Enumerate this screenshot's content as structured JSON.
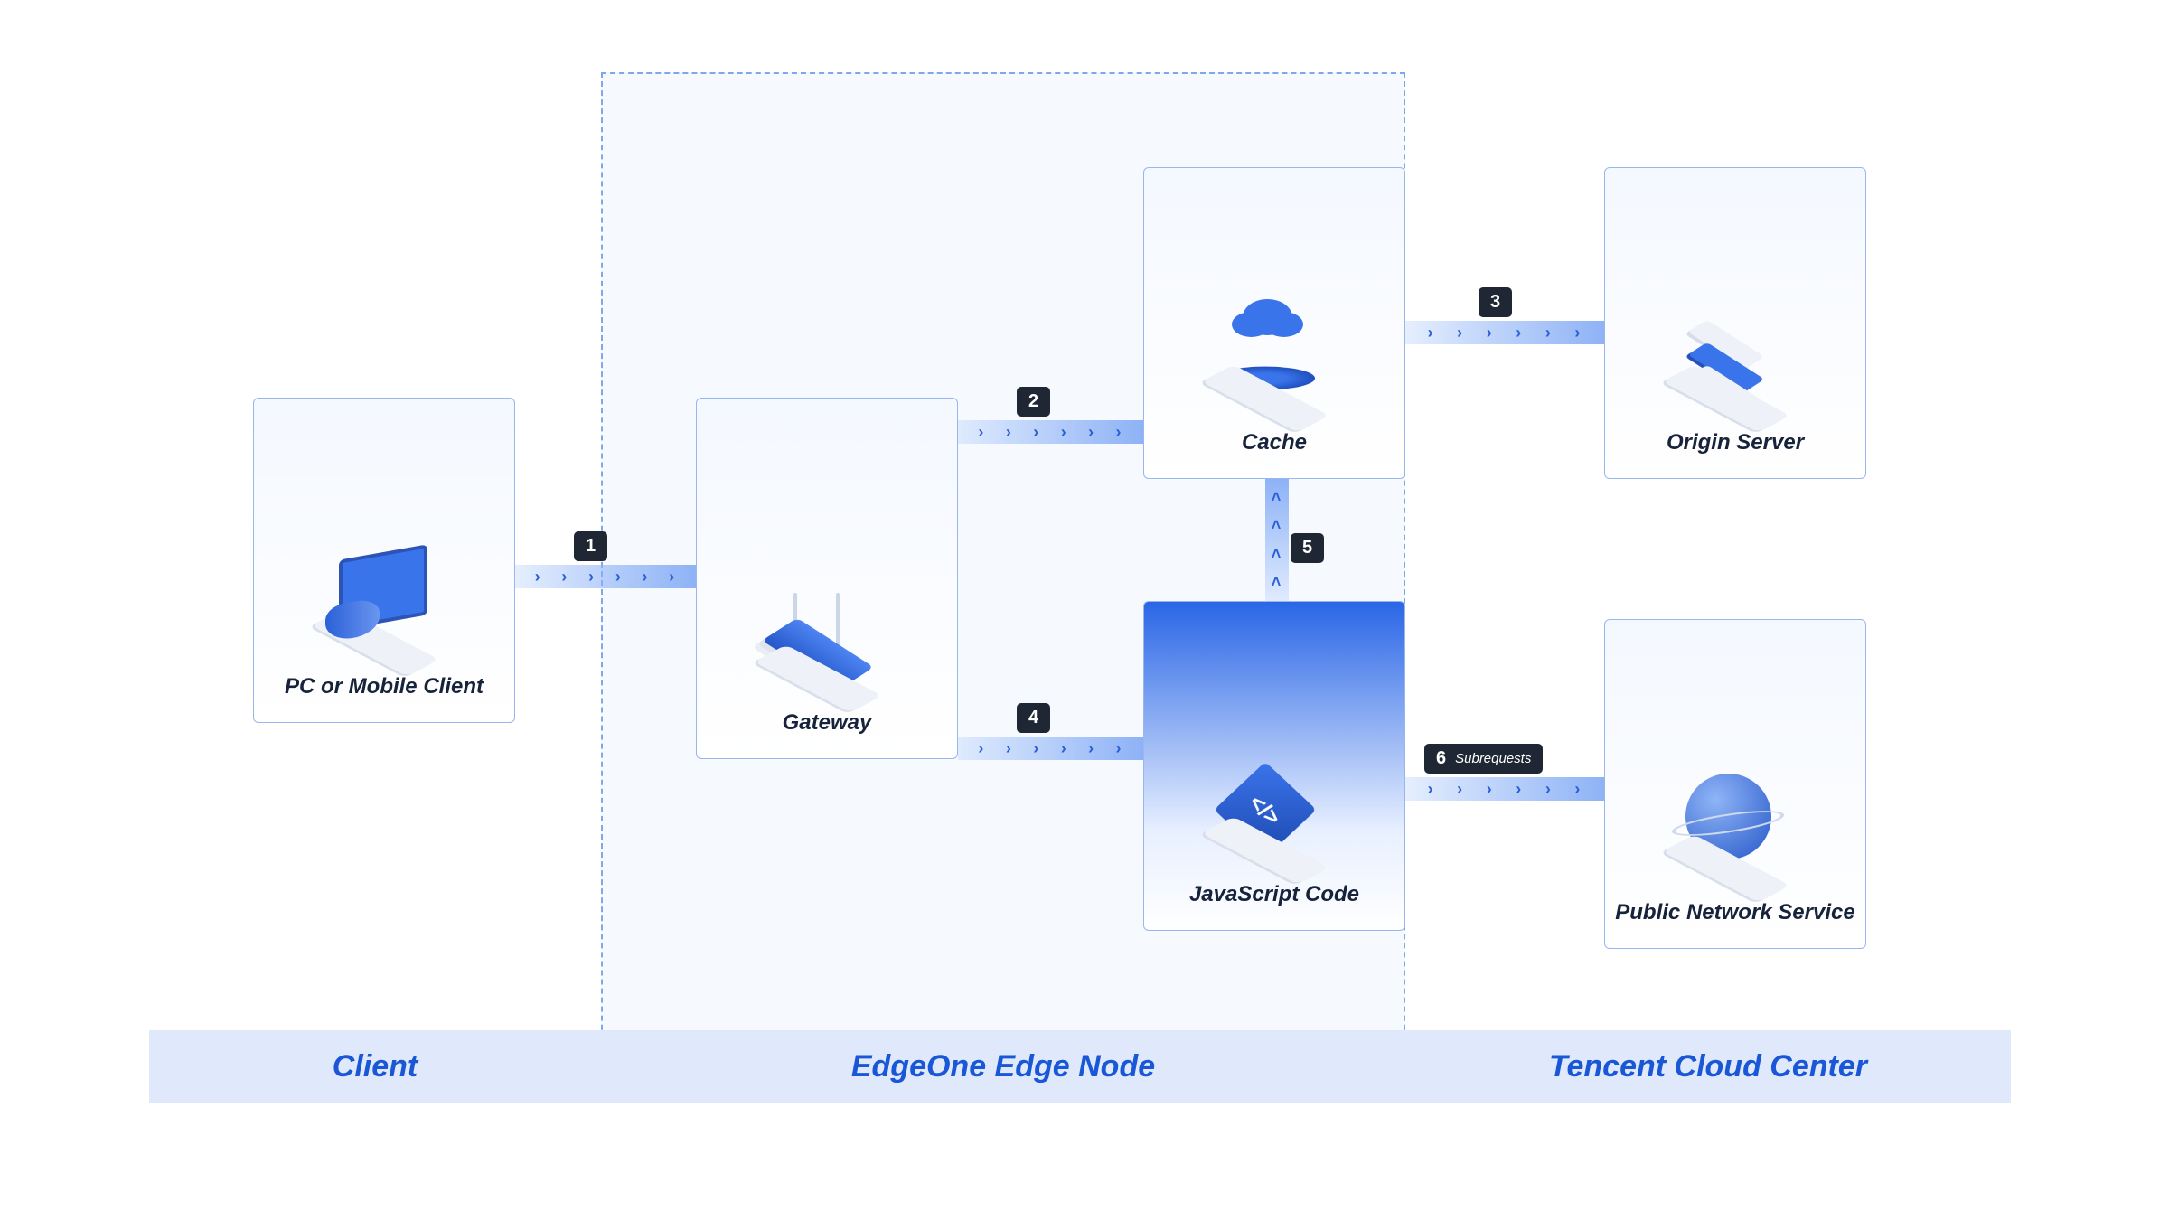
{
  "zones": {
    "client": "Client",
    "edge": "EdgeOne Edge Node",
    "center": "Tencent Cloud Center"
  },
  "nodes": {
    "client": {
      "label": "PC or Mobile Client"
    },
    "gateway": {
      "label": "Gateway"
    },
    "cache": {
      "label": "Cache"
    },
    "jscode": {
      "label": "JavaScript Code"
    },
    "origin": {
      "label": "Origin Server"
    },
    "public": {
      "label": "Public Network Service"
    }
  },
  "steps": {
    "s1": "1",
    "s2": "2",
    "s3": "3",
    "s4": "4",
    "s5": "5",
    "s6": "6",
    "s6_sub": "Subrequests"
  },
  "arrows": {
    "a1": {
      "from": "client",
      "to": "gateway",
      "dir": "right"
    },
    "a2": {
      "from": "gateway",
      "to": "cache",
      "dir": "right"
    },
    "a3": {
      "from": "cache",
      "to": "origin",
      "dir": "right"
    },
    "a4": {
      "from": "gateway",
      "to": "jscode",
      "dir": "right"
    },
    "a5": {
      "from": "jscode",
      "to": "cache",
      "dir": "up"
    },
    "a6": {
      "from": "jscode",
      "to": "public",
      "dir": "right"
    }
  },
  "colors": {
    "accent": "#2a5fd6",
    "badge_bg": "#1e2733",
    "card_border": "#9ab6ef",
    "zone_bg": "#dfe9fb"
  }
}
